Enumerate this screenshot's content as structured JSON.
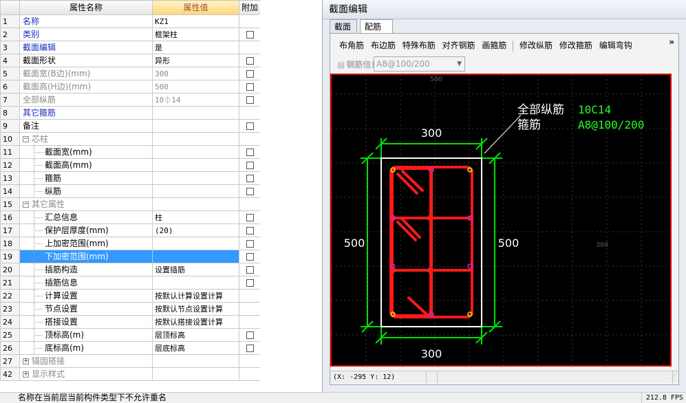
{
  "grid": {
    "header": {
      "name": "属性名称",
      "value": "属性值",
      "extra": "附加"
    },
    "rows": [
      {
        "num": "1",
        "name": "名称",
        "value": "KZ1",
        "style": "blue",
        "check": false
      },
      {
        "num": "2",
        "name": "类别",
        "value": "框架柱",
        "style": "blue",
        "check": true
      },
      {
        "num": "3",
        "name": "截面编辑",
        "value": "是",
        "style": "blue",
        "check": false
      },
      {
        "num": "4",
        "name": "截面形状",
        "value": "异形",
        "style": "",
        "check": true
      },
      {
        "num": "5",
        "name": "截面宽(B边)(mm)",
        "value": "300",
        "style": "gray",
        "check": true
      },
      {
        "num": "6",
        "name": "截面高(H边)(mm)",
        "value": "500",
        "style": "gray",
        "check": true
      },
      {
        "num": "7",
        "name": "全部纵筋",
        "value": "10⏀14",
        "style": "gray",
        "check": true
      },
      {
        "num": "8",
        "name": "其它箍筋",
        "value": "",
        "style": "blue",
        "check": false
      },
      {
        "num": "9",
        "name": "备注",
        "value": "",
        "style": "",
        "check": true
      },
      {
        "num": "10",
        "name": "芯柱",
        "value": "",
        "style": "group",
        "check": false
      },
      {
        "num": "11",
        "name": "截面宽(mm)",
        "value": "",
        "style": "indent",
        "check": true
      },
      {
        "num": "12",
        "name": "截面高(mm)",
        "value": "",
        "style": "indent",
        "check": true
      },
      {
        "num": "13",
        "name": "箍筋",
        "value": "",
        "style": "indent",
        "check": true
      },
      {
        "num": "14",
        "name": "纵筋",
        "value": "",
        "style": "indent",
        "check": true
      },
      {
        "num": "15",
        "name": "其它属性",
        "value": "",
        "style": "group",
        "check": false
      },
      {
        "num": "16",
        "name": "汇总信息",
        "value": "柱",
        "style": "indent",
        "check": true
      },
      {
        "num": "17",
        "name": "保护层厚度(mm)",
        "value": "(20)",
        "style": "indent",
        "check": true
      },
      {
        "num": "18",
        "name": "上加密范围(mm)",
        "value": "",
        "style": "indent",
        "check": true
      },
      {
        "num": "19",
        "name": "下加密范围(mm)",
        "value": "",
        "style": "indent-sel",
        "check": true
      },
      {
        "num": "20",
        "name": "插筋构造",
        "value": "设置插筋",
        "style": "indent",
        "check": true
      },
      {
        "num": "21",
        "name": "插筋信息",
        "value": "",
        "style": "indent",
        "check": true
      },
      {
        "num": "22",
        "name": "计算设置",
        "value": "按默认计算设置计算",
        "style": "indent",
        "check": false
      },
      {
        "num": "23",
        "name": "节点设置",
        "value": "按默认节点设置计算",
        "style": "indent",
        "check": false
      },
      {
        "num": "24",
        "name": "搭接设置",
        "value": "按默认搭接设置计算",
        "style": "indent",
        "check": false
      },
      {
        "num": "25",
        "name": "顶标高(m)",
        "value": "层顶标高",
        "style": "indent",
        "check": true
      },
      {
        "num": "26",
        "name": "底标高(m)",
        "value": "层底标高",
        "style": "indent",
        "check": true
      },
      {
        "num": "27",
        "name": "锚固搭接",
        "value": "",
        "style": "group-collapsed",
        "check": false
      },
      {
        "num": "42",
        "name": "显示样式",
        "value": "",
        "style": "group-collapsed",
        "check": false
      }
    ]
  },
  "editor": {
    "title": "截面编辑",
    "tabs": [
      "截面",
      "配筋"
    ],
    "active_tab": 1,
    "toolbar": [
      "布角筋",
      "布边筋",
      "特殊布筋",
      "对齐钢筋",
      "画箍筋",
      "修改纵筋",
      "修改箍筋",
      "编辑弯钩"
    ],
    "more": "»",
    "rebar_label": "钢筋信息",
    "rebar_value": "A8@100/200",
    "canvas": {
      "axis_top": "500",
      "axis_right": "300",
      "dim_top": "300",
      "dim_bottom": "300",
      "dim_left": "500",
      "dim_right": "500",
      "leader_label1": "全部纵筋",
      "leader_label2": "箍筋",
      "leader_value1": "10C14",
      "leader_value2": "A8@100/200"
    },
    "coords": "(X: -295 Y: 12)"
  },
  "statusbar": {
    "message": "名称在当前层当前构件类型下不允许重名",
    "fps": "212.8 FPS"
  },
  "colors": {
    "canvas_bg": "#000000",
    "rebar": "#ff1a1a",
    "dimension": "#00e000",
    "outline": "#ffffff",
    "selection": "#3399ff"
  }
}
